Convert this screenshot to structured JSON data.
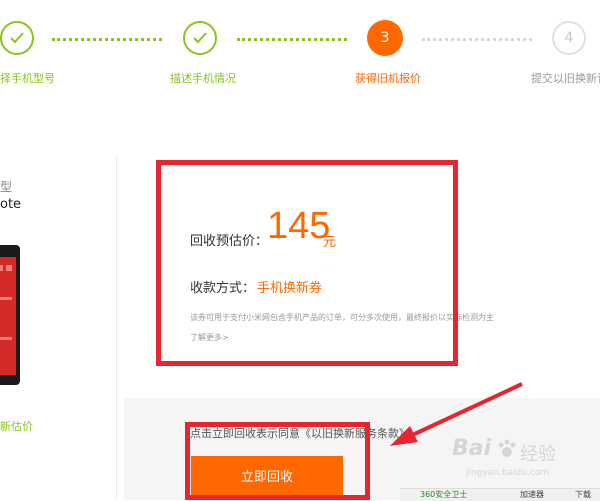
{
  "steps": [
    {
      "label": "择手机型号",
      "state": "done"
    },
    {
      "label": "描述手机情况",
      "state": "done"
    },
    {
      "number": "3",
      "label": "获得旧机报价",
      "state": "active"
    },
    {
      "number": "4",
      "label": "提交以旧换新订",
      "state": "todo"
    }
  ],
  "left_panel": {
    "model_type": "型",
    "model_name": "ote",
    "estimate_link": "新估价"
  },
  "quote": {
    "price_label": "回收预估价：",
    "price_value": "145",
    "price_unit": "元",
    "payment_label": "收款方式：",
    "payment_value": "手机换新券",
    "note": "该券可用于支付小米网包含手机产品的订单，可分多次使用，最终报价以实际检测为主",
    "more_link": "了解更多>"
  },
  "agreement": {
    "text": "点击立即回收表示同意《以旧换新服务条款》"
  },
  "actions": {
    "recycle_now": "立即回收"
  },
  "taskbar": {
    "item1": "360安全卫士",
    "item2": "加速器",
    "item3": "下载"
  },
  "watermark": {
    "brand": "Bai",
    "brand2": "经验",
    "url": "jingyan.baidu.com"
  },
  "colors": {
    "accent": "#ff6700",
    "step_done": "#8dc21f",
    "annotation_red": "#e8252f"
  }
}
